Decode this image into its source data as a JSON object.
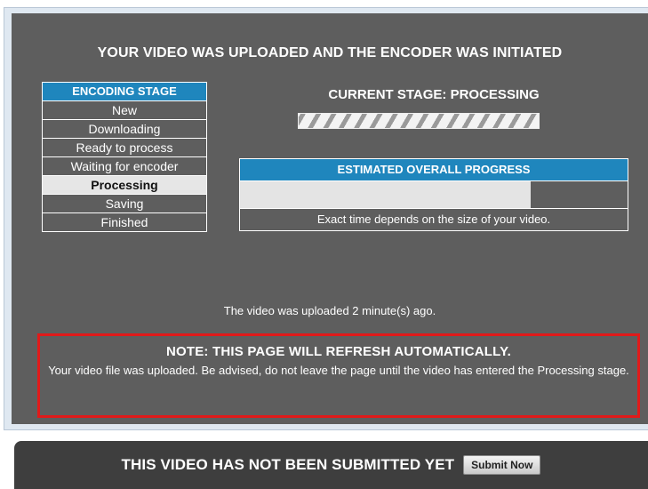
{
  "headline": "YOUR VIDEO WAS UPLOADED AND THE ENCODER WAS INITIATED",
  "stages": {
    "header": "ENCODING STAGE",
    "items": [
      "New",
      "Downloading",
      "Ready to process",
      "Waiting for encoder",
      "Processing",
      "Saving",
      "Finished"
    ],
    "active": "Processing"
  },
  "current_stage": "CURRENT STAGE: PROCESSING",
  "progress": {
    "header": "ESTIMATED OVERALL PROGRESS",
    "fraction": 0.75,
    "note": "Exact time depends on the size of your video."
  },
  "upload_time": "The video was uploaded 2 minute(s) ago.",
  "note": {
    "title": "NOTE: THIS PAGE WILL REFRESH AUTOMATICALLY.",
    "text": "Your video file was uploaded. Be advised, do not leave the page until the video has entered the Processing stage."
  },
  "submit_bar": {
    "label": "THIS VIDEO HAS NOT BEEN SUBMITTED YET",
    "button": "Submit Now"
  },
  "colors": {
    "panel": "#5e5e5e",
    "header_blue": "#1f86bd",
    "note_border": "#e01a1a",
    "submit_bar": "#3e3e3e"
  }
}
